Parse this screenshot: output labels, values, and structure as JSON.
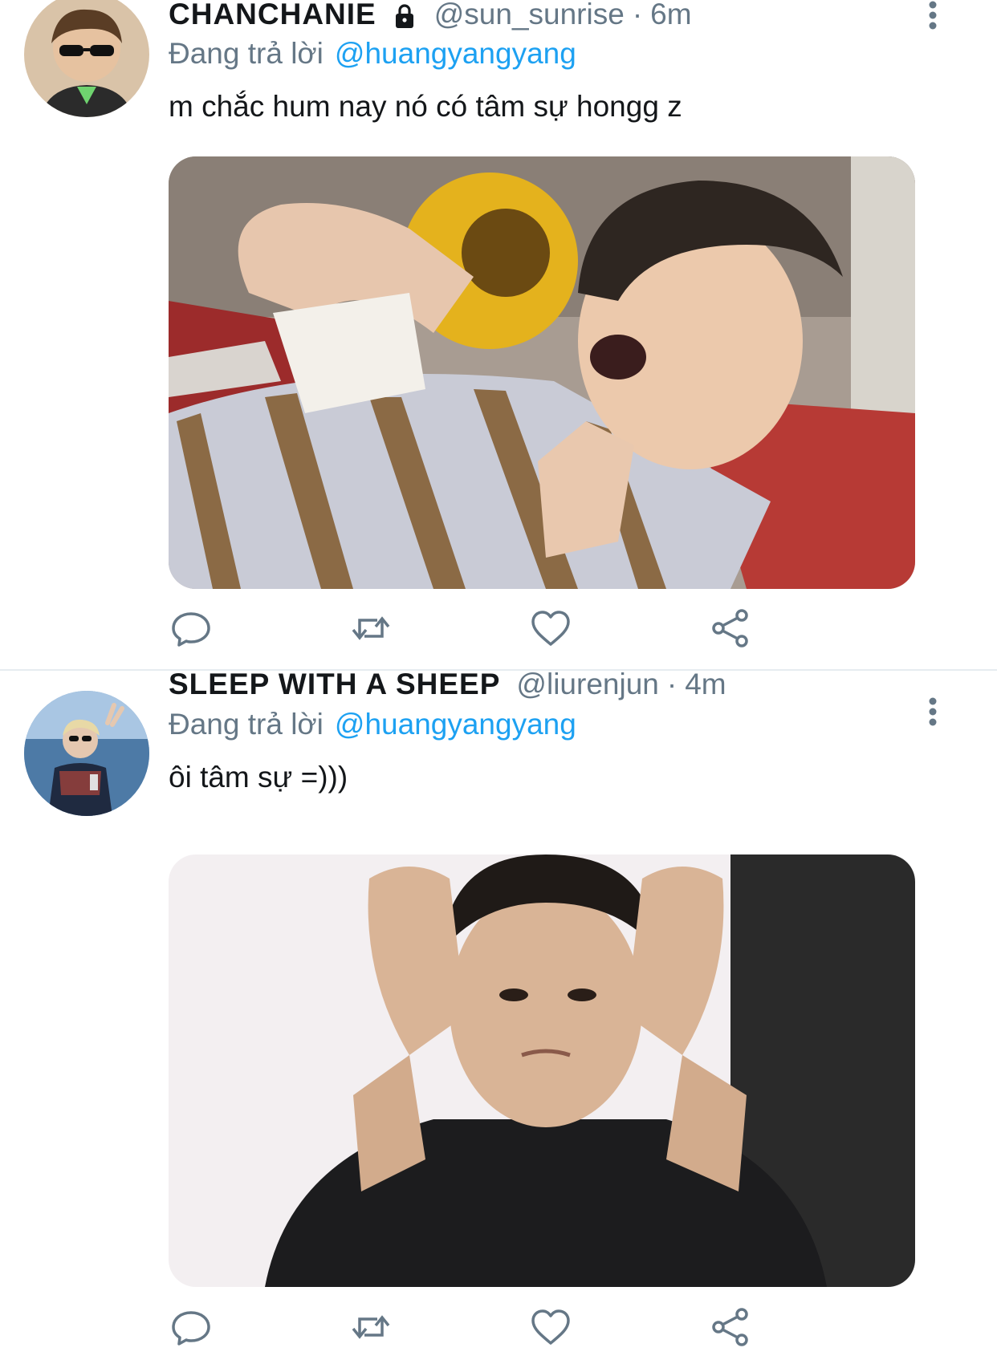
{
  "tweets": [
    {
      "name": "CHANCHANIE",
      "locked_icon": "lock-icon",
      "handle": "@sun_sunrise",
      "separator": "·",
      "time": "6m",
      "reply_prefix": "Đang trả lời",
      "reply_to": "@huangyangyang",
      "text": "m chắc hum nay nó có tâm sự hongg z",
      "media": "photo of a young man lying down with a shocked expression, wearing a striped shirt, sunflower behind"
    },
    {
      "name": "SLEEP WITH A SHEEP",
      "handle": "@liurenjun",
      "separator": "·",
      "time": "4m",
      "reply_prefix": "Đang trả lời",
      "reply_to": "@huangyangyang",
      "text": "ôi tâm sự =)))",
      "media": "photo of a young man in a black shirt holding his head with both hands"
    }
  ],
  "action_icons": [
    "reply-icon",
    "retweet-icon",
    "like-icon",
    "share-icon"
  ],
  "colors": {
    "accent": "#1da1f2",
    "secondary_text": "#657786",
    "primary_text": "#14171a",
    "divider": "#e6ecf0"
  }
}
